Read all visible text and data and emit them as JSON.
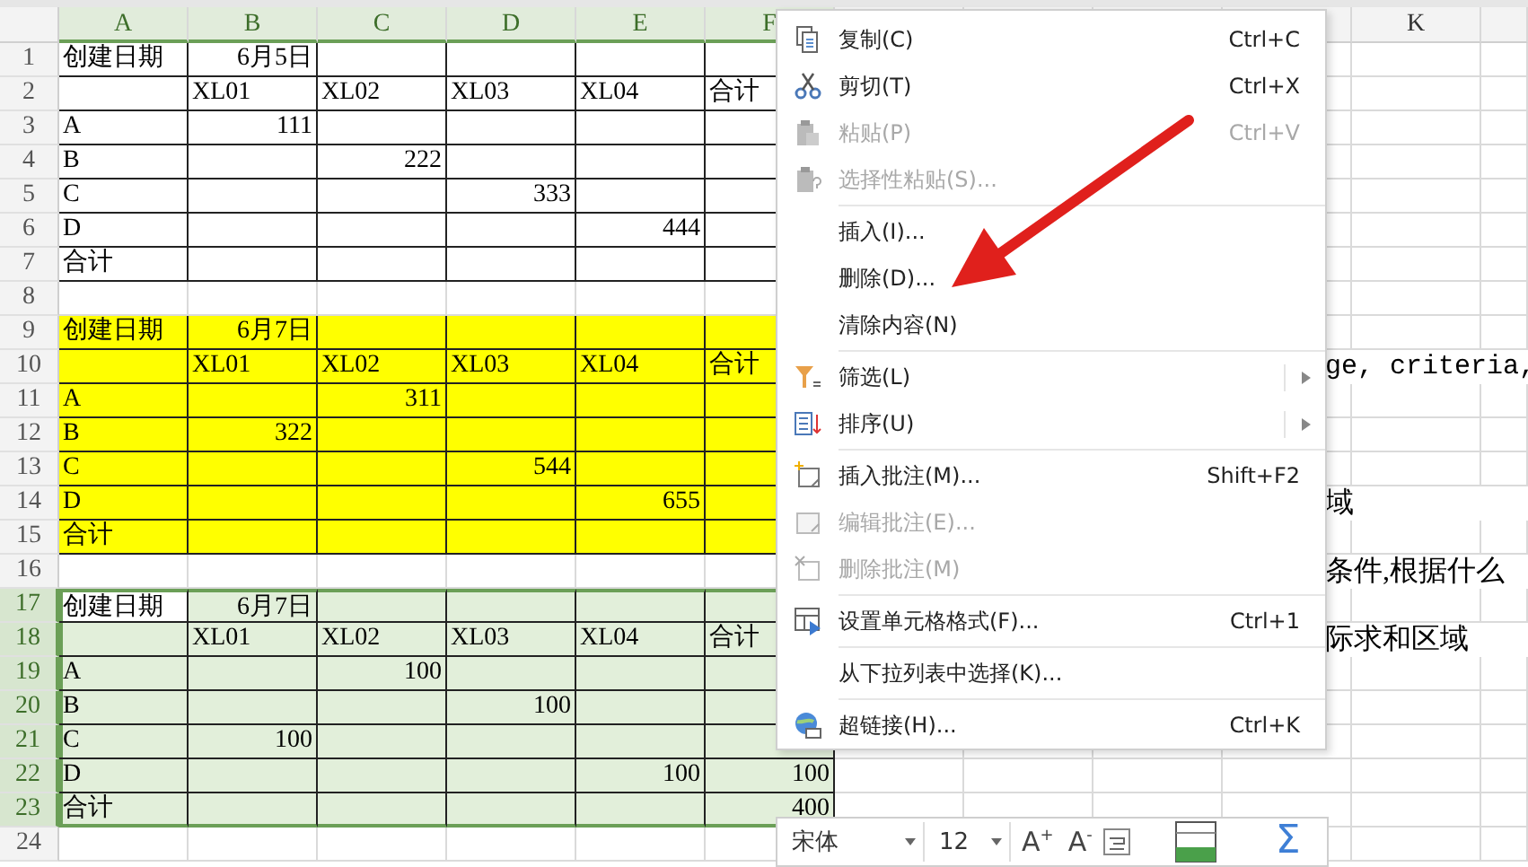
{
  "sheet": {
    "columns": [
      {
        "label": "A",
        "selected": true
      },
      {
        "label": "B",
        "selected": true
      },
      {
        "label": "C",
        "selected": true
      },
      {
        "label": "D",
        "selected": true
      },
      {
        "label": "E",
        "selected": true
      },
      {
        "label": "F",
        "selected": true
      },
      null,
      null,
      null,
      null,
      {
        "label": "K",
        "selected": false
      },
      null
    ],
    "rows": [
      {
        "number": "1",
        "selected": false,
        "bordered": true,
        "color": "#ffffff",
        "cells": [
          {
            "text": "创建日期",
            "kind": "text"
          },
          {
            "text": "6月5日",
            "kind": "number"
          },
          null,
          null,
          null,
          null
        ]
      },
      {
        "number": "2",
        "selected": false,
        "bordered": true,
        "color": "#ffffff",
        "cells": [
          null,
          {
            "text": "XL01",
            "kind": "text"
          },
          {
            "text": "XL02",
            "kind": "text"
          },
          {
            "text": "XL03",
            "kind": "text"
          },
          {
            "text": "XL04",
            "kind": "text"
          },
          {
            "text": "合计",
            "kind": "text"
          }
        ]
      },
      {
        "number": "3",
        "selected": false,
        "bordered": true,
        "color": "#ffffff",
        "cells": [
          {
            "text": "A",
            "kind": "text"
          },
          {
            "text": "111",
            "kind": "number"
          },
          null,
          null,
          null,
          null
        ]
      },
      {
        "number": "4",
        "selected": false,
        "bordered": true,
        "color": "#ffffff",
        "cells": [
          {
            "text": "B",
            "kind": "text"
          },
          null,
          {
            "text": "222",
            "kind": "number"
          },
          null,
          null,
          null
        ]
      },
      {
        "number": "5",
        "selected": false,
        "bordered": true,
        "color": "#ffffff",
        "cells": [
          {
            "text": "C",
            "kind": "text"
          },
          null,
          null,
          {
            "text": "333",
            "kind": "number"
          },
          null,
          null
        ]
      },
      {
        "number": "6",
        "selected": false,
        "bordered": true,
        "color": "#ffffff",
        "cells": [
          {
            "text": "D",
            "kind": "text"
          },
          null,
          null,
          null,
          {
            "text": "444",
            "kind": "number"
          },
          null
        ]
      },
      {
        "number": "7",
        "selected": false,
        "bordered": true,
        "color": "#ffffff",
        "cells": [
          {
            "text": "合计",
            "kind": "text"
          },
          null,
          null,
          null,
          null,
          null
        ]
      },
      {
        "number": "8",
        "selected": false,
        "bordered": false,
        "color": "#ffffff",
        "cells": [
          null,
          null,
          null,
          null,
          null,
          null
        ]
      },
      {
        "number": "9",
        "selected": false,
        "bordered": true,
        "color": "#ffff00",
        "cells": [
          {
            "text": "创建日期",
            "kind": "text"
          },
          {
            "text": "6月7日",
            "kind": "number"
          },
          null,
          null,
          null,
          null
        ]
      },
      {
        "number": "10",
        "selected": false,
        "bordered": true,
        "color": "#ffff00",
        "cells": [
          null,
          {
            "text": "XL01",
            "kind": "text"
          },
          {
            "text": "XL02",
            "kind": "text"
          },
          {
            "text": "XL03",
            "kind": "text"
          },
          {
            "text": "XL04",
            "kind": "text"
          },
          {
            "text": "合计",
            "kind": "text"
          }
        ],
        "overflow_text": "ge, criteria,"
      },
      {
        "number": "11",
        "selected": false,
        "bordered": true,
        "color": "#ffff00",
        "cells": [
          {
            "text": "A",
            "kind": "text"
          },
          null,
          {
            "text": "311",
            "kind": "number"
          },
          null,
          null,
          null
        ]
      },
      {
        "number": "12",
        "selected": false,
        "bordered": true,
        "color": "#ffff00",
        "cells": [
          {
            "text": "B",
            "kind": "text"
          },
          {
            "text": "322",
            "kind": "number"
          },
          null,
          null,
          null,
          null
        ]
      },
      {
        "number": "13",
        "selected": false,
        "bordered": true,
        "color": "#ffff00",
        "cells": [
          {
            "text": "C",
            "kind": "text"
          },
          null,
          null,
          {
            "text": "544",
            "kind": "number"
          },
          null,
          null
        ]
      },
      {
        "number": "14",
        "selected": false,
        "bordered": true,
        "color": "#ffff00",
        "cells": [
          {
            "text": "D",
            "kind": "text"
          },
          null,
          null,
          null,
          {
            "text": "655",
            "kind": "number"
          },
          null
        ],
        "overflow_text": "域"
      },
      {
        "number": "15",
        "selected": false,
        "bordered": true,
        "color": "#ffff00",
        "cells": [
          {
            "text": "合计",
            "kind": "text"
          },
          null,
          null,
          null,
          null,
          null
        ]
      },
      {
        "number": "16",
        "selected": false,
        "bordered": false,
        "color": "#ffffff",
        "cells": [
          null,
          null,
          null,
          null,
          null,
          null
        ],
        "overflow_text": "条件,根据什么"
      },
      {
        "number": "17",
        "selected": true,
        "bordered": true,
        "color": "#e2efda",
        "cells": [
          {
            "text": "创建日期",
            "kind": "text",
            "active": true
          },
          {
            "text": "6月7日",
            "kind": "number"
          },
          null,
          null,
          null,
          null
        ]
      },
      {
        "number": "18",
        "selected": true,
        "bordered": true,
        "color": "#e2efda",
        "cells": [
          null,
          {
            "text": "XL01",
            "kind": "text"
          },
          {
            "text": "XL02",
            "kind": "text"
          },
          {
            "text": "XL03",
            "kind": "text"
          },
          {
            "text": "XL04",
            "kind": "text"
          },
          {
            "text": "合计",
            "kind": "text"
          }
        ],
        "overflow_text": "际求和区域"
      },
      {
        "number": "19",
        "selected": true,
        "bordered": true,
        "color": "#e2efda",
        "cells": [
          {
            "text": "A",
            "kind": "text"
          },
          null,
          {
            "text": "100",
            "kind": "number"
          },
          null,
          null,
          null
        ]
      },
      {
        "number": "20",
        "selected": true,
        "bordered": true,
        "color": "#e2efda",
        "cells": [
          {
            "text": "B",
            "kind": "text"
          },
          null,
          null,
          {
            "text": "100",
            "kind": "number"
          },
          null,
          null
        ]
      },
      {
        "number": "21",
        "selected": true,
        "bordered": true,
        "color": "#e2efda",
        "cells": [
          {
            "text": "C",
            "kind": "text"
          },
          {
            "text": "100",
            "kind": "number"
          },
          null,
          null,
          null,
          null
        ]
      },
      {
        "number": "22",
        "selected": true,
        "bordered": true,
        "color": "#e2efda",
        "cells": [
          {
            "text": "D",
            "kind": "text"
          },
          null,
          null,
          null,
          {
            "text": "100",
            "kind": "number"
          },
          {
            "text": "100",
            "kind": "number"
          }
        ]
      },
      {
        "number": "23",
        "selected": true,
        "bordered": true,
        "color": "#e2efda",
        "cells": [
          {
            "text": "合计",
            "kind": "text"
          },
          null,
          null,
          null,
          null,
          {
            "text": "400",
            "kind": "number"
          }
        ]
      },
      {
        "number": "24",
        "selected": false,
        "bordered": false,
        "color": "#ffffff",
        "cells": [
          null,
          null,
          null,
          null,
          null,
          null
        ]
      }
    ]
  },
  "context_menu": {
    "items": [
      {
        "kind": "item",
        "label": "复制(C)",
        "shortcut": "Ctrl+C",
        "disabled": false,
        "submenu": false
      },
      {
        "kind": "item",
        "label": "剪切(T)",
        "shortcut": "Ctrl+X",
        "disabled": false,
        "submenu": false
      },
      {
        "kind": "item",
        "label": "粘贴(P)",
        "shortcut": "Ctrl+V",
        "disabled": true,
        "submenu": false
      },
      {
        "kind": "item",
        "label": "选择性粘贴(S)...",
        "disabled": true,
        "submenu": false
      },
      {
        "kind": "separator"
      },
      {
        "kind": "item",
        "label": "插入(I)...",
        "disabled": false,
        "submenu": false
      },
      {
        "kind": "item",
        "label": "删除(D)...",
        "disabled": false,
        "submenu": false
      },
      {
        "kind": "item",
        "label": "清除内容(N)",
        "disabled": false,
        "submenu": false
      },
      {
        "kind": "separator"
      },
      {
        "kind": "item",
        "label": "筛选(L)",
        "disabled": false,
        "submenu": true
      },
      {
        "kind": "item",
        "label": "排序(U)",
        "disabled": false,
        "submenu": true
      },
      {
        "kind": "separator"
      },
      {
        "kind": "item",
        "label": "插入批注(M)...",
        "shortcut": "Shift+F2",
        "disabled": false,
        "submenu": false
      },
      {
        "kind": "item",
        "label": "编辑批注(E)...",
        "disabled": true,
        "submenu": false
      },
      {
        "kind": "item",
        "label": "删除批注(M)",
        "disabled": true,
        "submenu": false
      },
      {
        "kind": "separator"
      },
      {
        "kind": "item",
        "label": "设置单元格格式(F)...",
        "shortcut": "Ctrl+1",
        "disabled": false,
        "submenu": false
      },
      {
        "kind": "separator"
      },
      {
        "kind": "item",
        "label": "从下拉列表中选择(K)...",
        "disabled": false,
        "submenu": false
      },
      {
        "kind": "separator"
      },
      {
        "kind": "item",
        "label": "超链接(H)...",
        "shortcut": "Ctrl+K",
        "disabled": false,
        "submenu": false
      }
    ]
  },
  "mini_toolbar": {
    "font": "宋体",
    "size": "12",
    "grow": "A$^{+}$",
    "shrink": "A$^{-}$",
    "sum": "Σ"
  }
}
